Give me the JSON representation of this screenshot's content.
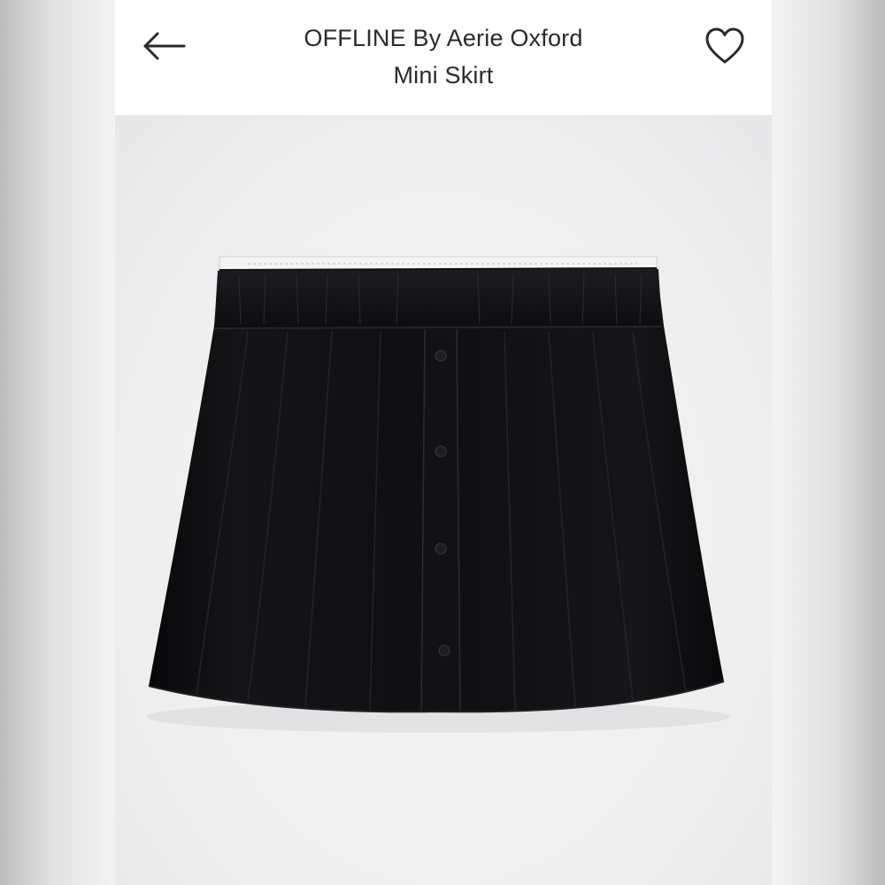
{
  "header": {
    "title_line1": "OFFLINE By Aerie Oxford",
    "title_line2": "Mini Skirt",
    "back_icon": "arrow-left-icon",
    "favorite_icon": "heart-outline-icon"
  },
  "product": {
    "image_subject": "skirt-image",
    "colors": {
      "fabric": "#0d0d0f",
      "background": "#efeff0",
      "header": "#ffffff",
      "text": "#2a2a2a"
    }
  }
}
